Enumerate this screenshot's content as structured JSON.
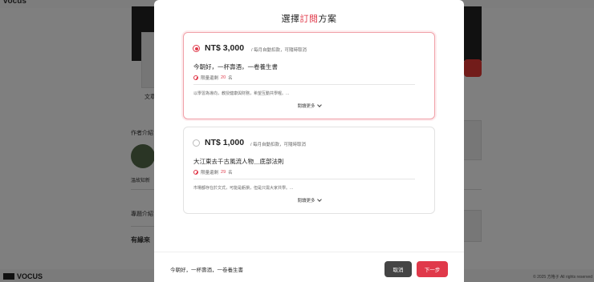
{
  "background": {
    "brand_top": "vocus",
    "author_intro": "作者介紹",
    "author_name": "溫故知新",
    "book_intro": "專題介紹",
    "related": "有緣來",
    "card_label": "文章",
    "brand": "VOCUS",
    "copyright": "© 2025 方格子 All rights reserved"
  },
  "modal": {
    "title_prefix": "選擇",
    "title_highlight": "訂閱",
    "title_suffix": "方案",
    "plans": [
      {
        "selected": true,
        "price": "NT$ 3,000",
        "price_note": "/ 每月自動扣款，可隨時取消",
        "name": "今朝好，一杯壽酒，一卷養生書",
        "limit_prefix": "限量還剩",
        "limit_count": "20",
        "limit_unit": "名",
        "description": "以學習為導向，教授健康與財務，希望互動共學喔。...",
        "expand_label": "閱讀更多"
      },
      {
        "selected": false,
        "price": "NT$ 1,000",
        "price_note": "/ 每月自動扣款，可隨時取消",
        "name": "大江東去千古風流人物＿底部法則",
        "limit_prefix": "限量還剩",
        "limit_count": "29",
        "limit_unit": "名",
        "description": "市場都存在於文式，可能是虧損，但是只需大家共學。...",
        "expand_label": "閱讀更多"
      }
    ],
    "footer": {
      "selected_plan_name": "今朝好，一杯壽酒，一卷養生書",
      "cancel_label": "取消",
      "next_label": "下一步"
    }
  },
  "colors": {
    "accent": "#e0394a",
    "cancel_button": "#444444",
    "selected_border": "#f0a0a8"
  }
}
